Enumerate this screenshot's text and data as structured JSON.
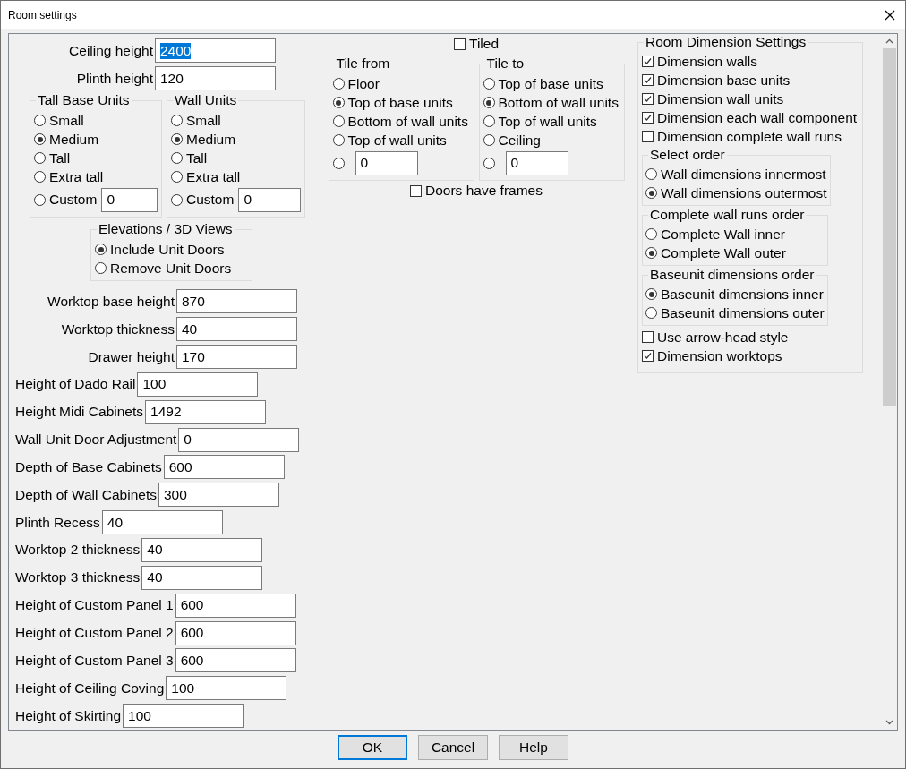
{
  "window": {
    "title": "Room settings"
  },
  "left": {
    "top_fields": [
      {
        "label": "Ceiling height",
        "value": "2400",
        "text_selected": true
      },
      {
        "label": "Plinth height",
        "value": "120",
        "text_selected": false
      }
    ],
    "unit_groups": [
      {
        "title": "Tall Base Units",
        "options": [
          {
            "label": "Small",
            "selected": false
          },
          {
            "label": "Medium",
            "selected": true
          },
          {
            "label": "Tall",
            "selected": false
          },
          {
            "label": "Extra tall",
            "selected": false
          },
          {
            "label": "Custom",
            "selected": false,
            "value": "0"
          }
        ]
      },
      {
        "title": "Wall Units",
        "options": [
          {
            "label": "Small",
            "selected": false
          },
          {
            "label": "Medium",
            "selected": true
          },
          {
            "label": "Tall",
            "selected": false
          },
          {
            "label": "Extra tall",
            "selected": false
          },
          {
            "label": "Custom",
            "selected": false,
            "value": "0"
          }
        ]
      }
    ],
    "elevations": {
      "title": "Elevations / 3D Views",
      "options": [
        {
          "label": "Include Unit Doors",
          "selected": true
        },
        {
          "label": "Remove Unit Doors",
          "selected": false
        }
      ]
    },
    "worktop_fields": [
      {
        "label": "Worktop base height",
        "value": "870"
      },
      {
        "label": "Worktop thickness",
        "value": "40"
      },
      {
        "label": "Drawer height",
        "value": "170"
      }
    ],
    "fields": [
      {
        "label": "Height of Dado Rail",
        "value": "100"
      },
      {
        "label": "Height Midi Cabinets",
        "value": "1492"
      },
      {
        "label": "Wall Unit Door Adjustment",
        "value": "0"
      },
      {
        "label": "Depth of Base Cabinets",
        "value": "600"
      },
      {
        "label": "Depth of Wall Cabinets",
        "value": "300"
      },
      {
        "label": "Plinth Recess",
        "value": "40"
      },
      {
        "label": "Worktop 2 thickness",
        "value": "40"
      },
      {
        "label": "Worktop 3 thickness",
        "value": "40"
      },
      {
        "label": "Height of Custom Panel 1",
        "value": "600"
      },
      {
        "label": "Height of Custom Panel 2",
        "value": "600"
      },
      {
        "label": "Height of Custom Panel 3",
        "value": "600"
      },
      {
        "label": "Height of Ceiling Coving",
        "value": "100"
      },
      {
        "label": "Height of Skirting",
        "value": "100"
      }
    ]
  },
  "middle": {
    "tiled": {
      "label": "Tiled",
      "checked": false
    },
    "tile_groups": [
      {
        "title": "Tile from",
        "options": [
          {
            "label": "Floor",
            "selected": false
          },
          {
            "label": "Top of base units",
            "selected": true
          },
          {
            "label": "Bottom of wall units",
            "selected": false
          },
          {
            "label": "Top of wall units",
            "selected": false
          },
          {
            "selected": false,
            "value": "0"
          }
        ]
      },
      {
        "title": "Tile to",
        "options": [
          {
            "label": "Top of base units",
            "selected": false
          },
          {
            "label": "Bottom of wall units",
            "selected": true
          },
          {
            "label": "Top of wall units",
            "selected": false
          },
          {
            "label": "Ceiling",
            "selected": false
          },
          {
            "selected": false,
            "value": "0"
          }
        ]
      }
    ],
    "doors_have_frames": {
      "label": "Doors have frames",
      "checked": false
    }
  },
  "right": {
    "title": "Room Dimension Settings",
    "items": [
      {
        "kind": "checkbox",
        "label": "Dimension walls",
        "checked": true
      },
      {
        "kind": "checkbox",
        "label": "Dimension base units",
        "checked": true
      },
      {
        "kind": "checkbox",
        "label": "Dimension wall units",
        "checked": true
      },
      {
        "kind": "checkbox",
        "label": "Dimension each wall component",
        "checked": true
      },
      {
        "kind": "checkbox",
        "label": "Dimension complete wall runs",
        "checked": false
      },
      {
        "kind": "group",
        "title": "Select order",
        "options": [
          {
            "label": "Wall dimensions innermost",
            "selected": false
          },
          {
            "label": "Wall dimensions outermost",
            "selected": true
          }
        ]
      },
      {
        "kind": "group",
        "title": "Complete wall runs order",
        "options": [
          {
            "label": "Complete Wall inner",
            "selected": false
          },
          {
            "label": "Complete Wall outer",
            "selected": true
          }
        ]
      },
      {
        "kind": "group",
        "title": "Baseunit dimensions order",
        "options": [
          {
            "label": "Baseunit dimensions inner",
            "selected": true
          },
          {
            "label": "Baseunit dimensions outer",
            "selected": false
          }
        ]
      },
      {
        "kind": "checkbox",
        "label": "Use arrow-head style",
        "checked": false
      },
      {
        "kind": "checkbox",
        "label": "Dimension worktops",
        "checked": true
      }
    ]
  },
  "buttons": [
    {
      "label": "OK",
      "default": true
    },
    {
      "label": "Cancel",
      "default": false
    },
    {
      "label": "Help",
      "default": false
    }
  ]
}
